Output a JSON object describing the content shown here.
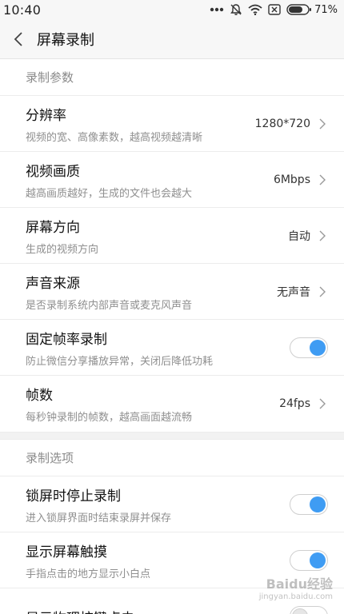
{
  "status_bar": {
    "time": "10:40",
    "battery": "71%",
    "icons": [
      "more-dots-icon",
      "mute-bell-icon",
      "wifi-icon",
      "no-sim-icon",
      "battery-icon"
    ]
  },
  "header": {
    "title": "屏幕录制"
  },
  "sections": [
    {
      "title": "录制参数",
      "rows": [
        {
          "title": "分辨率",
          "subtitle": "视频的宽、高像素数，越高视频越清晰",
          "value": "1280*720"
        },
        {
          "title": "视频画质",
          "subtitle": "越高画质越好，生成的文件也会越大",
          "value": "6Mbps"
        },
        {
          "title": "屏幕方向",
          "subtitle": "生成的视频方向",
          "value": "自动"
        },
        {
          "title": "声音来源",
          "subtitle": "是否录制系统内部声音或麦克风声音",
          "value": "无声音"
        },
        {
          "title": "固定帧率录制",
          "subtitle": "防止微信分享播放异常，关闭后降低功耗",
          "toggle": true
        },
        {
          "title": "帧数",
          "subtitle": "每秒钟录制的帧数，越高画面越流畅",
          "value": "24fps"
        }
      ]
    },
    {
      "title": "录制选项",
      "rows": [
        {
          "title": "锁屏时停止录制",
          "subtitle": "进入锁屏界面时结束录屏并保存",
          "toggle": true
        },
        {
          "title": "显示屏幕触摸",
          "subtitle": "手指点击的地方显示小白点",
          "toggle": true
        },
        {
          "title": "显示物理按键点击",
          "subtitle": "",
          "toggle": false
        }
      ]
    }
  ],
  "watermark": {
    "text": "Baidu经验",
    "sub": "jingyan.baidu.com"
  },
  "colors": {
    "accent": "#3f9cf3",
    "background": "#f7f7f7"
  }
}
